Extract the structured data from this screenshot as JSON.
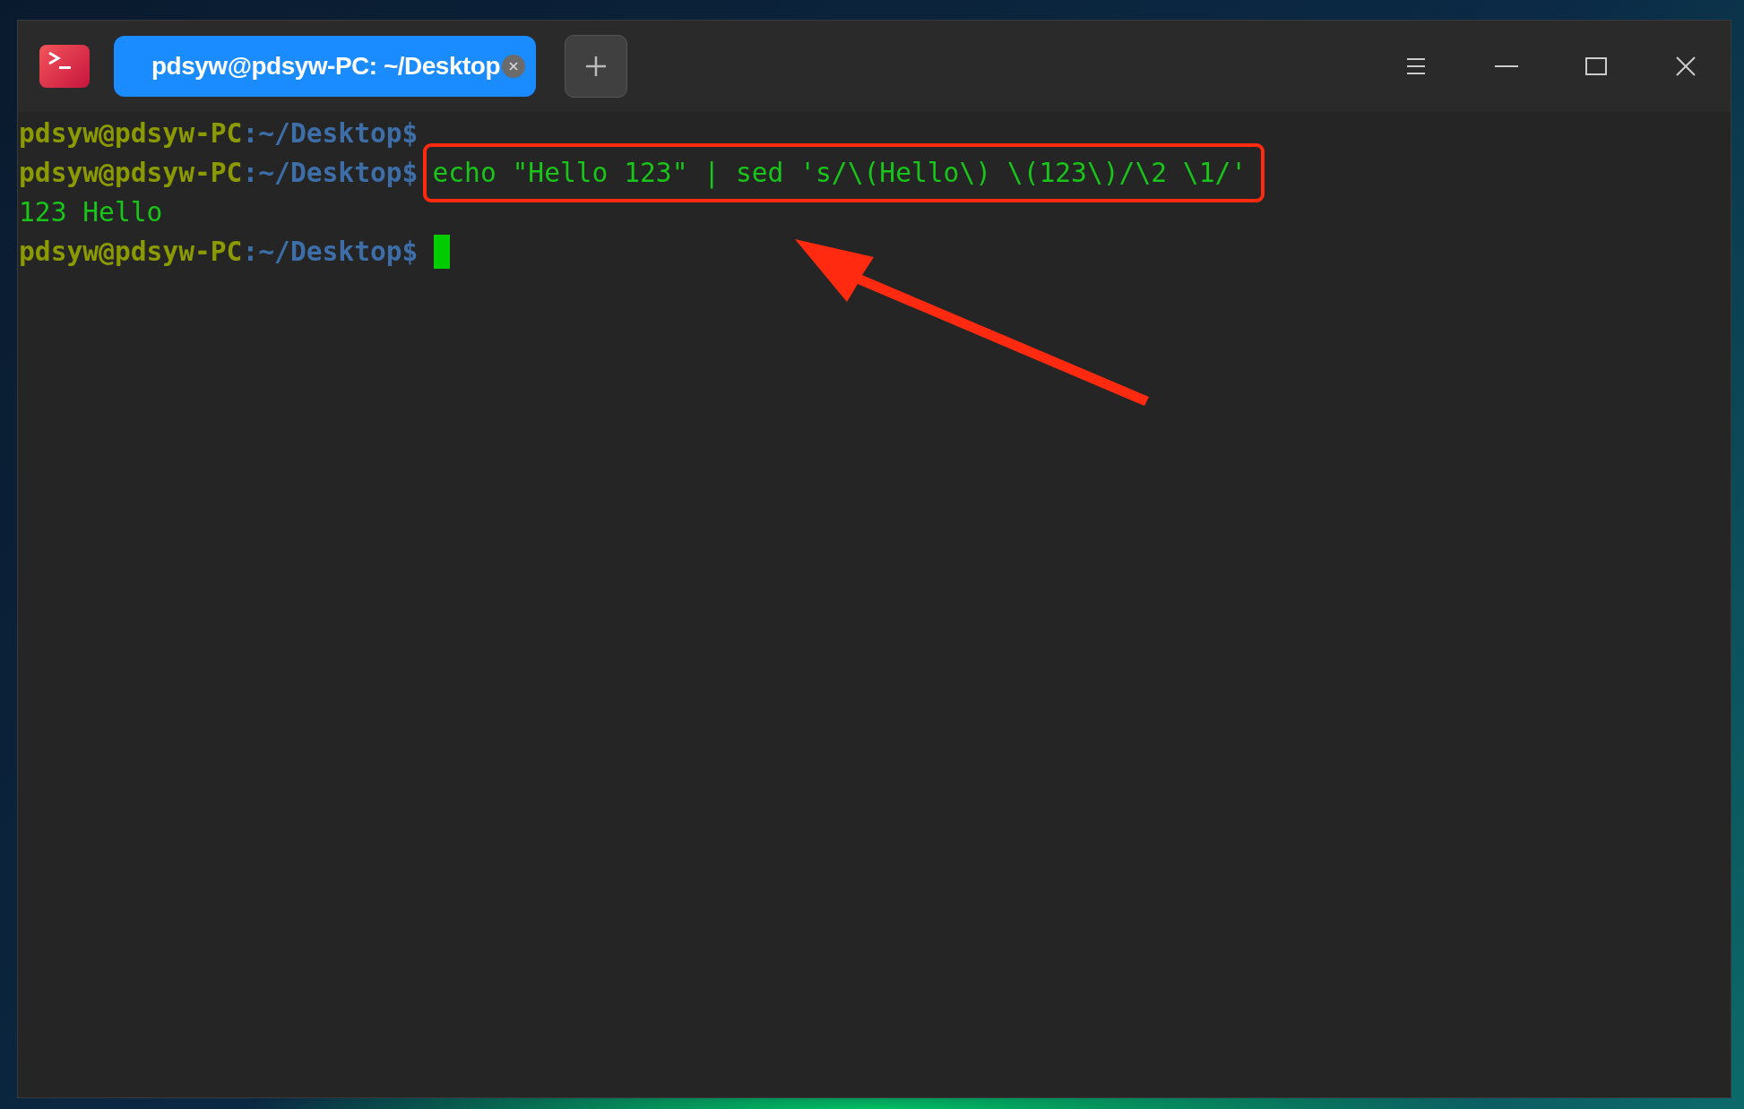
{
  "tabs": [
    {
      "label": "pdsyw@pdsyw-PC: ~/Desktop",
      "selected": true
    }
  ],
  "terminal": {
    "lines": [
      {
        "kind": "prompt",
        "user_host": "pdsyw@pdsyw-PC",
        "path": ":~/Desktop$",
        "highlighted": false,
        "cursor": false
      },
      {
        "kind": "prompt",
        "user_host": "pdsyw@pdsyw-PC",
        "path": ":~/Desktop$",
        "command": "echo \"Hello 123\" | sed 's/\\(Hello\\) \\(123\\)/\\2 \\1/'",
        "highlighted": true,
        "cursor": false
      },
      {
        "kind": "output",
        "text": "123 Hello"
      },
      {
        "kind": "prompt",
        "user_host": "pdsyw@pdsyw-PC",
        "path": ":~/Desktop$",
        "highlighted": false,
        "cursor": true
      }
    ]
  },
  "annotations": [
    {
      "kind": "arrow"
    }
  ]
}
